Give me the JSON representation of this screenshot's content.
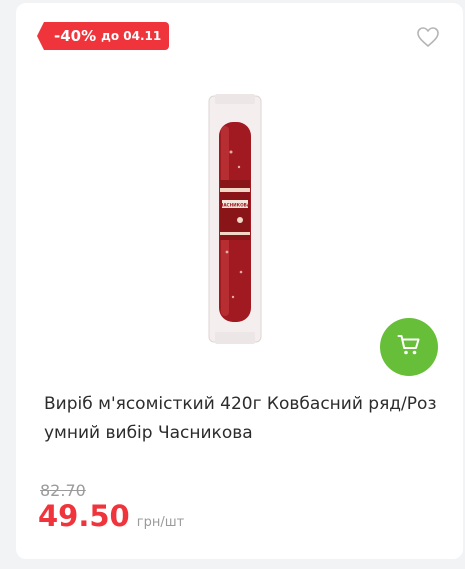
{
  "badge": {
    "discount": "-40%",
    "until": "до 04.11"
  },
  "favorite": {
    "icon": "heart-outline-icon"
  },
  "product": {
    "title": "Виріб м'ясомісткий 420г Ковбасний ряд/Розумний вибір Часникова",
    "image_alt": "sausage-product-image",
    "package_label": "ЧАСНИКОВА"
  },
  "cart": {
    "icon": "cart-icon",
    "color": "#67bf39"
  },
  "price": {
    "old": "82.70",
    "current": "49.50",
    "unit": "грн/шт",
    "color": "#f0343b"
  }
}
